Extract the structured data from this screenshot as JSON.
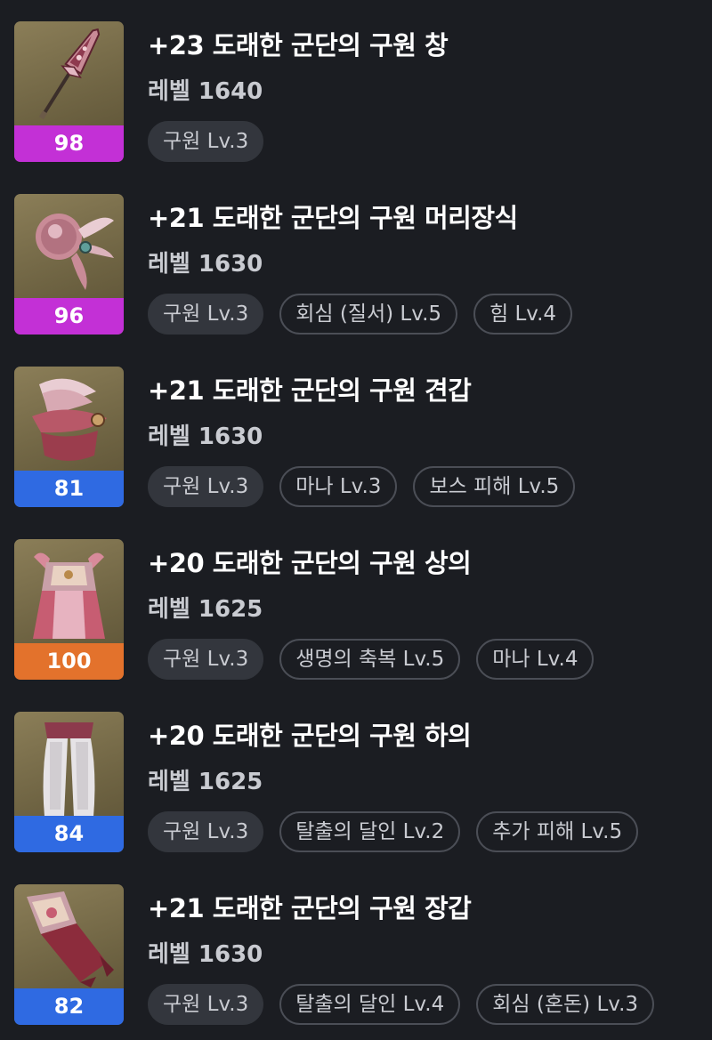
{
  "items": [
    {
      "title": "+23 도래한 군단의 구원 창",
      "level": "레벨 1640",
      "quality": "98",
      "quality_color": "#c330d6",
      "icon": "spear-icon",
      "tags": [
        "구원 Lv.3"
      ]
    },
    {
      "title": "+21 도래한 군단의 구원 머리장식",
      "level": "레벨 1630",
      "quality": "96",
      "quality_color": "#c330d6",
      "icon": "headpiece-icon",
      "tags": [
        "구원 Lv.3",
        "회심 (질서) Lv.5",
        "힘 Lv.4"
      ]
    },
    {
      "title": "+21 도래한 군단의 구원 견갑",
      "level": "레벨 1630",
      "quality": "81",
      "quality_color": "#2f6ae2",
      "icon": "shoulder-icon",
      "tags": [
        "구원 Lv.3",
        "마나 Lv.3",
        "보스 피해 Lv.5"
      ]
    },
    {
      "title": "+20 도래한 군단의 구원 상의",
      "level": "레벨 1625",
      "quality": "100",
      "quality_color": "#e3722c",
      "icon": "chest-armor-icon",
      "tags": [
        "구원 Lv.3",
        "생명의 축복 Lv.5",
        "마나 Lv.4"
      ]
    },
    {
      "title": "+20 도래한 군단의 구원 하의",
      "level": "레벨 1625",
      "quality": "84",
      "quality_color": "#2f6ae2",
      "icon": "pants-icon",
      "tags": [
        "구원 Lv.3",
        "탈출의 달인 Lv.2",
        "추가 피해 Lv.5"
      ]
    },
    {
      "title": "+21 도래한 군단의 구원 장갑",
      "level": "레벨 1630",
      "quality": "82",
      "quality_color": "#2f6ae2",
      "icon": "gloves-icon",
      "tags": [
        "구원 Lv.3",
        "탈출의 달인 Lv.4",
        "회심 (혼돈) Lv.3"
      ]
    }
  ]
}
